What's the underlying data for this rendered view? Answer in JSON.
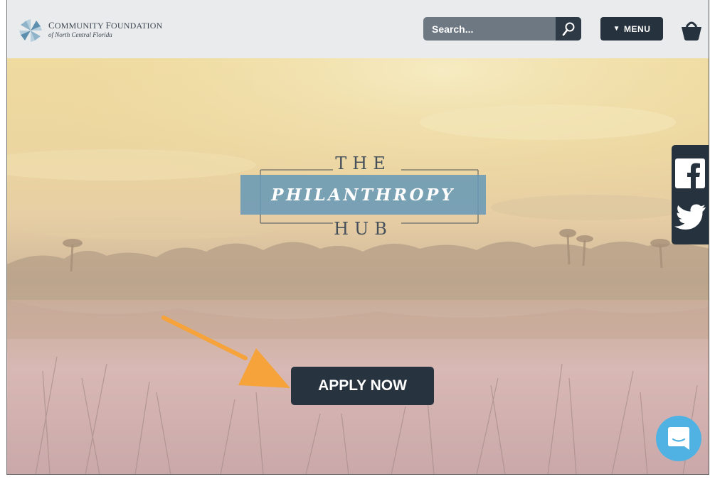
{
  "header": {
    "org_name_line1_a": "C",
    "org_name_line1_b": "OMMUNITY ",
    "org_name_line1_c": "F",
    "org_name_line1_d": "OUNDATION",
    "org_name_line2": "of North Central Florida",
    "logo_icon": "pinwheel-logo",
    "search_placeholder": "Search...",
    "search_icon": "magnifier-icon",
    "menu_label": "MENU",
    "menu_icon": "triangle-down-icon",
    "cart_icon": "basket-icon"
  },
  "hero": {
    "title_top": "THE",
    "title_main": "PHILANTHROPY",
    "title_bottom": "HUB",
    "cta_label": "APPLY NOW",
    "annotation_icon": "orange-arrow-icon"
  },
  "social": {
    "facebook_icon": "facebook-icon",
    "twitter_icon": "twitter-icon"
  },
  "chat": {
    "chat_icon": "chat-bubble-icon"
  },
  "colors": {
    "header_bg": "#e9ebed",
    "dark_button": "#26323d",
    "band_blue": "#6798b7",
    "chat_blue": "#4fb2e3",
    "arrow_orange": "#f5a33a"
  }
}
